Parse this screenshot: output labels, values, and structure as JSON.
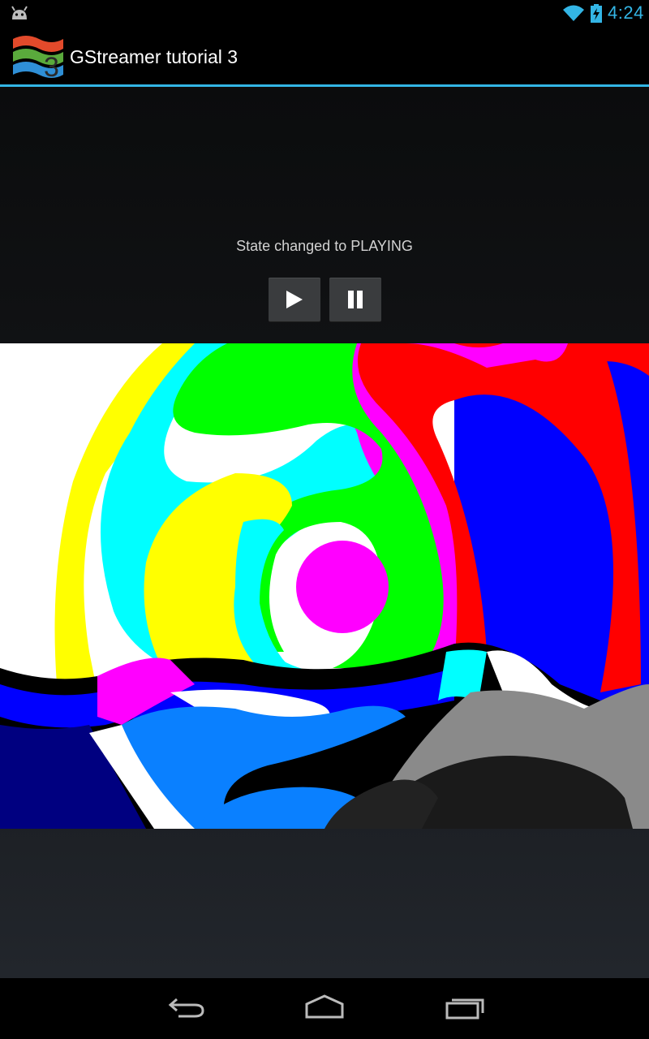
{
  "status_bar": {
    "time": "4:24",
    "icons": [
      "android-debug-icon",
      "wifi-icon",
      "battery-charging-icon"
    ],
    "accent_color": "#33b5e5"
  },
  "action_bar": {
    "title": "GStreamer tutorial 3",
    "logo_badge": "3",
    "divider_color": "#33b5e5"
  },
  "main": {
    "state_message": "State changed to PLAYING",
    "play_icon": "play-icon",
    "pause_icon": "pause-icon"
  },
  "video": {
    "content": "videotestsrc pattern playback"
  },
  "nav_bar": {
    "icons": [
      "back-icon",
      "home-icon",
      "recent-apps-icon"
    ]
  }
}
